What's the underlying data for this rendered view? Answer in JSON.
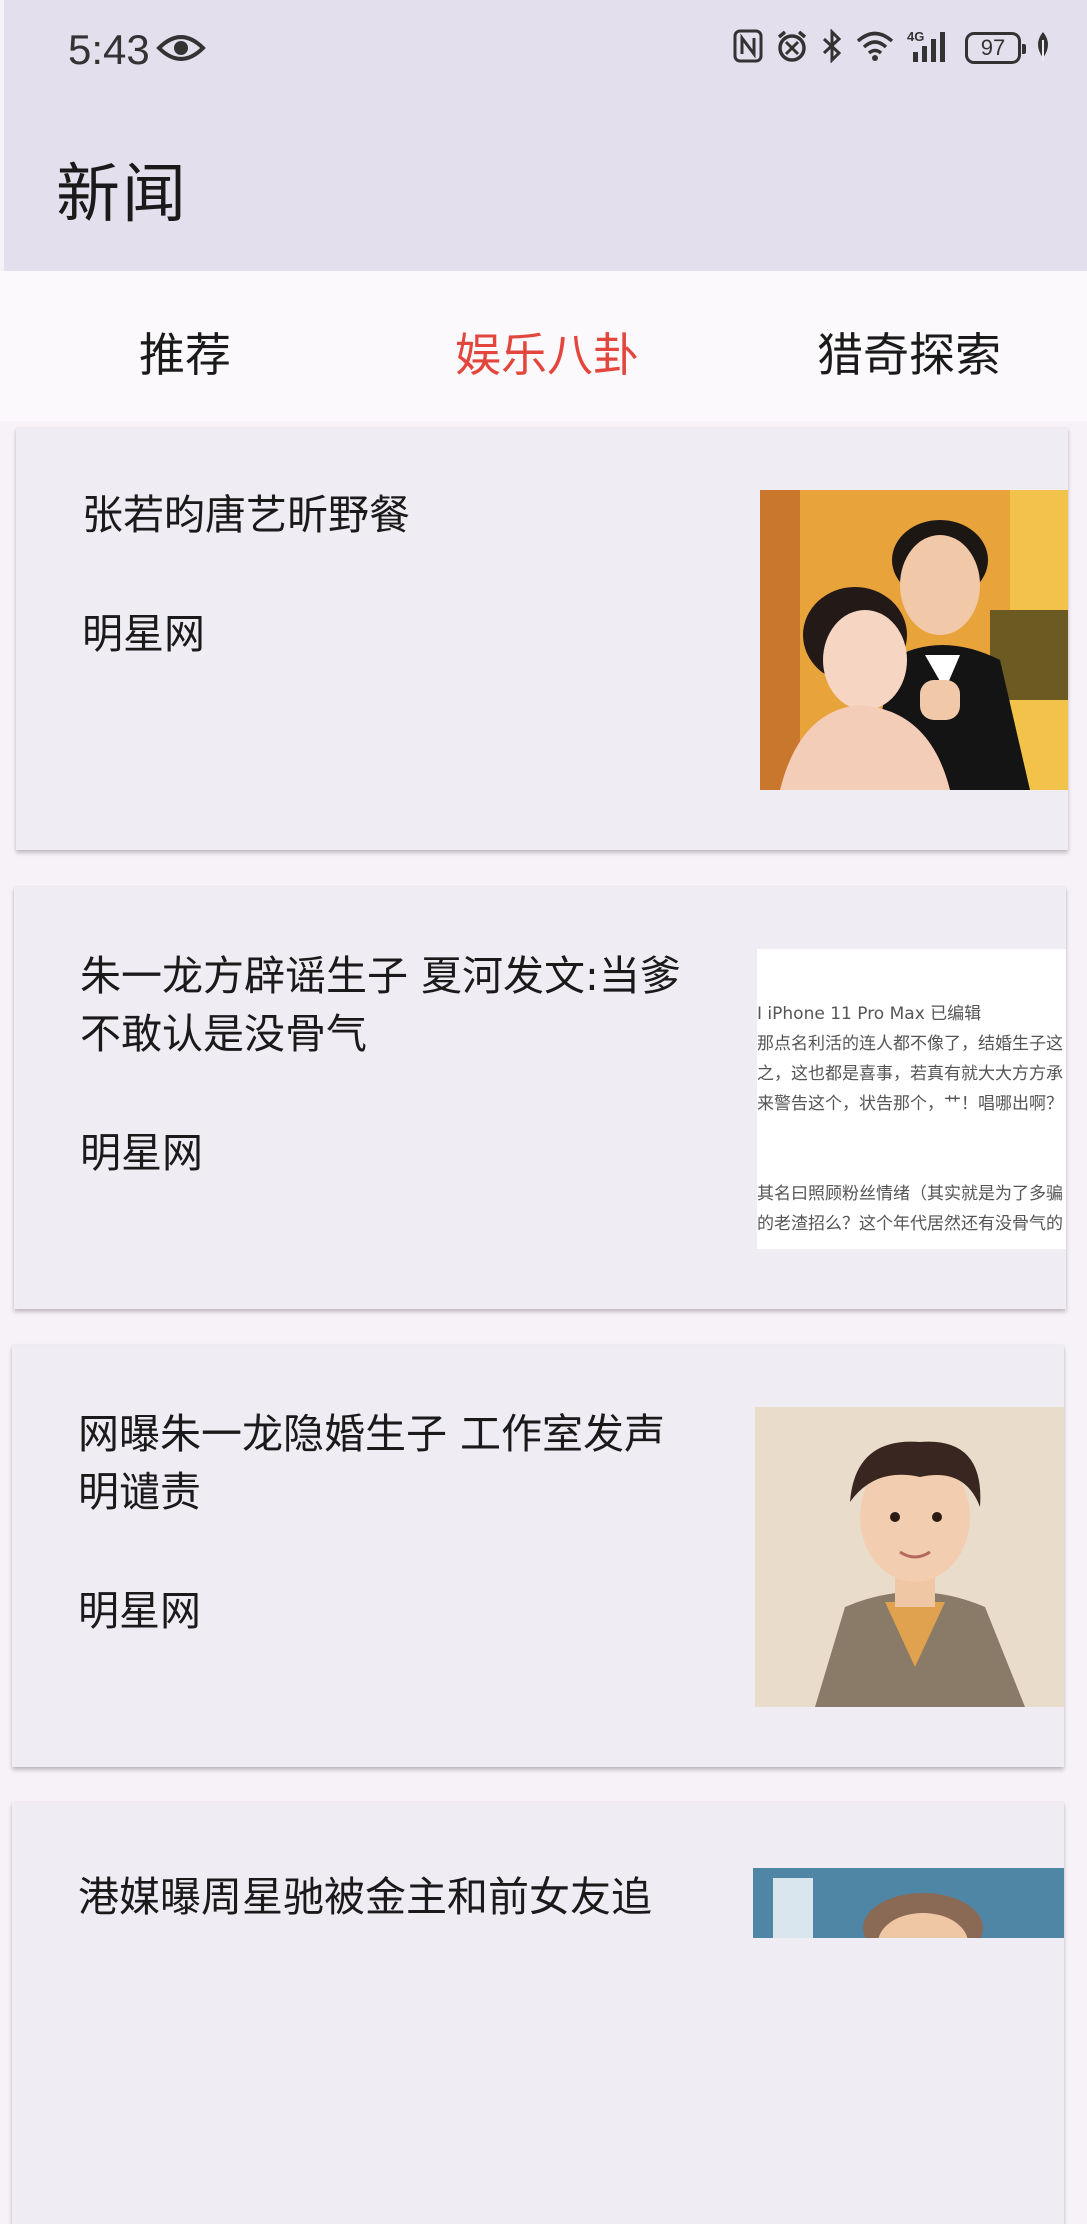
{
  "status_bar": {
    "time": "5:43",
    "network": "4G",
    "battery": "97",
    "icons": [
      "eye-icon",
      "nfc-icon",
      "alarm-icon",
      "bluetooth-icon",
      "wifi-icon",
      "signal-icon",
      "battery-icon",
      "leaf-icon"
    ]
  },
  "app_bar": {
    "title": "新闻"
  },
  "tabs": [
    {
      "label": "推荐",
      "active": false
    },
    {
      "label": "娱乐八卦",
      "active": true
    },
    {
      "label": "猎奇探索",
      "active": false
    }
  ],
  "colors": {
    "accent": "#e2463c",
    "app_bar_bg": "#e4dfec",
    "card_bg": "#f0ecf4"
  },
  "news": [
    {
      "title": "张若昀唐艺昕野餐",
      "source": "明星网"
    },
    {
      "title": "朱一龙方辟谣生子 夏河发文:当爹不敢认是没骨气",
      "source": "明星网",
      "thumb_text": [
        "I iPhone 11 Pro Max  已编辑",
        "那点名利活的连人都不像了，结婚生子这",
        "之，这也都是喜事，若真有就大大方方承",
        "来警告这个，状告那个，艹！唱哪出啊？",
        "其名曰照顾粉丝情绪（其实就是为了多骗",
        "的老渣招么？这个年代居然还有没骨气的"
      ]
    },
    {
      "title": "网曝朱一龙隐婚生子 工作室发声明谴责",
      "source": "明星网"
    },
    {
      "title": "港媒曝周星驰被金主和前女友追",
      "source": ""
    }
  ]
}
